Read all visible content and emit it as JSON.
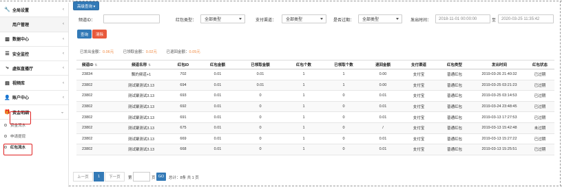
{
  "sidebar": {
    "items": [
      {
        "name": "nav-global-settings",
        "icon": "wrench-icon",
        "glyph": "🔧",
        "label": "全局设置"
      },
      {
        "name": "nav-user-management",
        "icon": "apple-icon",
        "glyph": "",
        "label": "用户管理"
      },
      {
        "name": "nav-data-center",
        "icon": "bar-chart-icon",
        "glyph": "▥",
        "label": "数据中心"
      },
      {
        "name": "nav-security-monitor",
        "icon": "list-icon",
        "glyph": "☰",
        "label": "安全监控"
      },
      {
        "name": "nav-virtual-live",
        "icon": "share-icon",
        "glyph": "⤷",
        "label": "虚拟直播厅"
      },
      {
        "name": "nav-video-library",
        "icon": "film-icon",
        "glyph": "▤",
        "label": "视频库"
      },
      {
        "name": "nav-account-center",
        "icon": "user-icon",
        "glyph": "👤",
        "label": "账户中心"
      },
      {
        "name": "nav-fund-details",
        "icon": "gift-icon",
        "glyph": "🎁",
        "label": "资金明细"
      }
    ],
    "sub_items": [
      "资金流水",
      "申请提现",
      "红包流水"
    ]
  },
  "toolbar": {
    "advanced_search": "高级查询 ▾"
  },
  "filters": {
    "channel_id_label": "频道ID：",
    "packet_type_label": "红包类型：",
    "packet_type_value": "全部类型",
    "pay_channel_label": "支付渠道：",
    "pay_channel_value": "全部类型",
    "expired_label": "是否过期：",
    "expired_value": "全部类型",
    "send_time_label": "发出时间：",
    "time_start": "2018-11-01 00:00:00",
    "time_to": "至",
    "time_end": "2020-03-25 11:35:42",
    "query_btn": "查询",
    "clear_btn": "清除"
  },
  "summary": {
    "sent_label": "已发出金额：",
    "sent_value": "0.06元",
    "received_label": "已领取金额：",
    "received_value": "0.02元",
    "refunded_label": "已退回金额：",
    "refunded_value": "0.05元"
  },
  "table": {
    "columns": [
      "频道ID",
      "频道名称",
      "红包ID",
      "红包金额",
      "已领取金额",
      "红包个数",
      "已领取个数",
      "退回金额",
      "支付渠道",
      "红包类型",
      "发出时间",
      "红包状态"
    ],
    "rows": [
      [
        "23834",
        "飘妁频道+1",
        "702",
        "0.01",
        "0.01",
        "1",
        "1",
        "0.00",
        "支付宝",
        "普通红包",
        "2019-03-26 21:40:32",
        "已过期"
      ],
      [
        "23802",
        "测试聚测试3.13",
        "694",
        "0.01",
        "0.01",
        "1",
        "1",
        "0.00",
        "支付宝",
        "普通红包",
        "2019-03-25 03:21:23",
        "已过期"
      ],
      [
        "23802",
        "测试聚测试3.13",
        "693",
        "0.01",
        "0",
        "1",
        "0",
        "0.01",
        "支付宝",
        "普通红包",
        "2019-03-25 03:14:53",
        "已过期"
      ],
      [
        "23802",
        "测试聚测试3.13",
        "692",
        "0.01",
        "0",
        "1",
        "0",
        "0.01",
        "支付宝",
        "普通红包",
        "2019-03-24 23:48:45",
        "已过期"
      ],
      [
        "23802",
        "测试聚测试3.13",
        "691",
        "0.01",
        "0",
        "1",
        "0",
        "0.01",
        "支付宝",
        "普通红包",
        "2019-03-13 17:27:53",
        "已过期"
      ],
      [
        "23802",
        "测试聚测试3.13",
        "675",
        "0.01",
        "0",
        "1",
        "0",
        "/",
        "支付宝",
        "普通红包",
        "2019-03-13 15:42:48",
        "未过期"
      ],
      [
        "23802",
        "测试聚测试3.13",
        "669",
        "0.01",
        "0",
        "1",
        "0",
        "0.01",
        "支付宝",
        "普通红包",
        "2019-03-13 15:27:22",
        "已过期"
      ],
      [
        "23802",
        "测试聚测试3.13",
        "668",
        "0.01",
        "0",
        "1",
        "0",
        "0.01",
        "支付宝",
        "普通红包",
        "2019-03-13 15:25:51",
        "已过期"
      ]
    ]
  },
  "pager": {
    "prev": "上一页",
    "current": "1",
    "next": "下一页",
    "goto_prefix": "第",
    "goto_suffix": "页",
    "go": "GO",
    "total": "总计：8条 共 1 页"
  }
}
